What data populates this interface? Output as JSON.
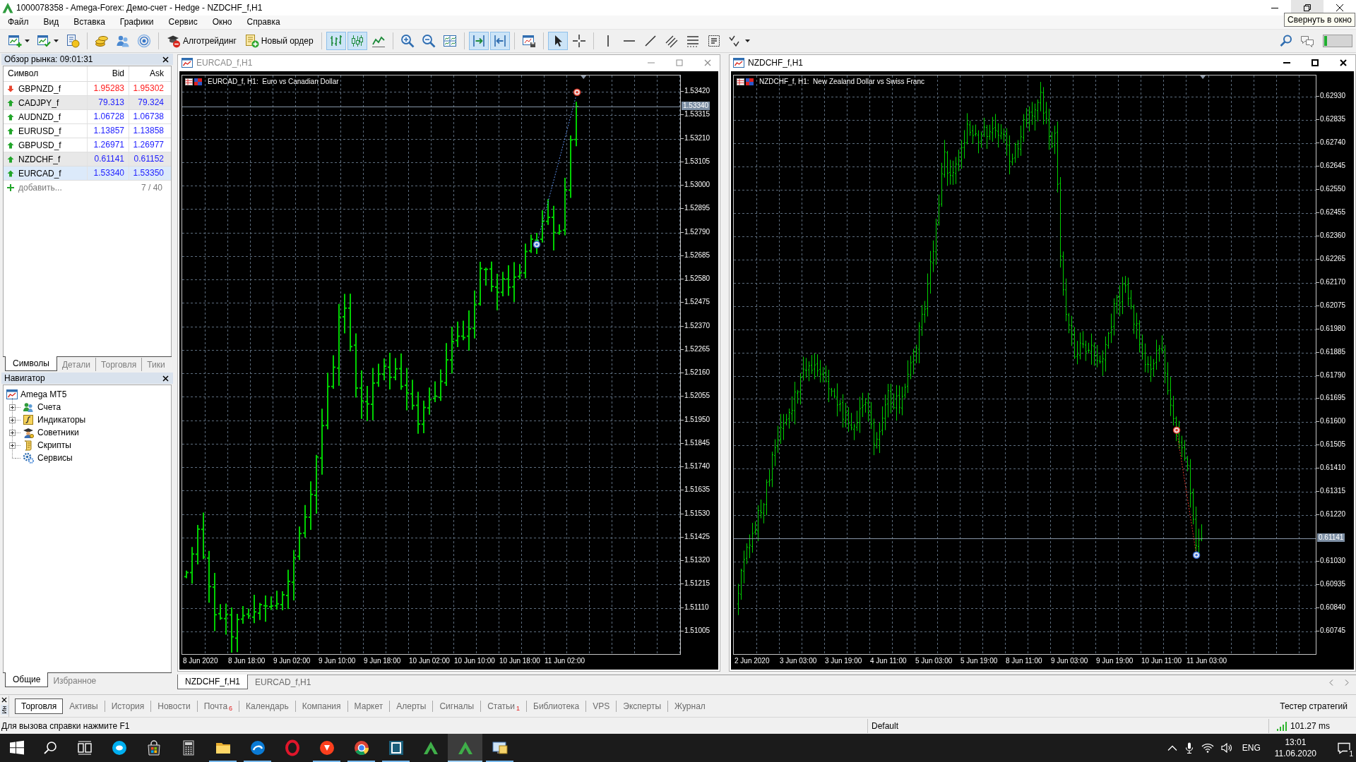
{
  "window": {
    "title": "1000078358 - Amega-Forex: Демо-счет - Hedge - NZDCHF_f,H1",
    "tooltip": "Свернуть в окно",
    "controls": [
      {
        "hovered": false
      },
      {
        "hovered": true
      },
      {
        "hovered": false
      }
    ]
  },
  "menu": [
    "Файл",
    "Вид",
    "Вставка",
    "Графики",
    "Сервис",
    "Окно",
    "Справка"
  ],
  "toolbar": {
    "buttons": [
      {
        "label": "Алготрейдинг"
      },
      {
        "label": "Новый ордер"
      }
    ],
    "chart_types": [
      {
        "selected": true
      },
      {
        "selected": true
      },
      {
        "selected": false
      }
    ],
    "view_toggles": [
      {
        "on": true
      },
      {
        "on": true
      }
    ],
    "cursor_tools": [
      {
        "selected": true
      },
      {
        "selected": false
      }
    ]
  },
  "market_watch": {
    "title": "Обзор рынка: 09:01:31",
    "columns": [
      "Символ",
      "Bid",
      "Ask"
    ],
    "rows": [
      {
        "symbol": "GBPNZD_f",
        "bid": "1.95283",
        "ask": "1.95302",
        "rising": false,
        "highlighted": false,
        "selected": false
      },
      {
        "symbol": "CADJPY_f",
        "bid": "79.313",
        "ask": "79.324",
        "rising": true,
        "highlighted": true,
        "selected": false
      },
      {
        "symbol": "AUDNZD_f",
        "bid": "1.06728",
        "ask": "1.06738",
        "rising": true,
        "highlighted": false,
        "selected": false
      },
      {
        "symbol": "EURUSD_f",
        "bid": "1.13857",
        "ask": "1.13858",
        "rising": true,
        "highlighted": false,
        "selected": false
      },
      {
        "symbol": "GBPUSD_f",
        "bid": "1.26971",
        "ask": "1.26977",
        "rising": true,
        "highlighted": false,
        "selected": false
      },
      {
        "symbol": "NZDCHF_f",
        "bid": "0.61141",
        "ask": "0.61152",
        "rising": true,
        "highlighted": true,
        "selected": false
      },
      {
        "symbol": "EURCAD_f",
        "bid": "1.53340",
        "ask": "1.53350",
        "rising": true,
        "highlighted": false,
        "selected": true
      }
    ],
    "add_label": "добавить...",
    "count": "7 / 40",
    "tabs": [
      {
        "label": "Символы",
        "selected": true
      },
      {
        "label": "Детали",
        "selected": false
      },
      {
        "label": "Торговля",
        "selected": false
      },
      {
        "label": "Тики",
        "selected": false
      }
    ]
  },
  "navigator": {
    "title": "Навигатор",
    "tree": [
      {
        "label": "Amega MT5",
        "expandable": false,
        "children": [
          {
            "label": "Счета",
            "expandable": true
          },
          {
            "label": "Индикаторы",
            "expandable": true
          },
          {
            "label": "Советники",
            "expandable": true
          },
          {
            "label": "Скрипты",
            "expandable": true
          },
          {
            "label": "Сервисы",
            "expandable": false
          }
        ]
      }
    ],
    "tabs": [
      {
        "label": "Общие",
        "selected": true
      },
      {
        "label": "Избранное",
        "selected": false
      }
    ]
  },
  "charts": [
    {
      "title": "EURCAD_f,H1",
      "active": false,
      "header": "EURCAD_f, H1:  Euro vs Canadian Dollar",
      "price_axis": [
        "1.53420",
        "1.53315",
        "1.53210",
        "1.53105",
        "1.53000",
        "1.52895",
        "1.52790",
        "1.52685",
        "1.52580",
        "1.52475",
        "1.52370",
        "1.52265",
        "1.52160",
        "1.52055",
        "1.51950",
        "1.51845",
        "1.51740",
        "1.51635",
        "1.51530",
        "1.51425",
        "1.51320",
        "1.51215",
        "1.51110",
        "1.51005"
      ],
      "current_price": "1.53340",
      "time_axis": [
        "8 Jun 2020",
        "8 Jun 18:00",
        "9 Jun 02:00",
        "9 Jun 10:00",
        "9 Jun 18:00",
        "10 Jun 02:00",
        "10 Jun 10:00",
        "10 Jun 18:00",
        "11 Jun 02:00"
      ]
    },
    {
      "title": "NZDCHF_f,H1",
      "active": true,
      "header": "NZDCHF_f, H1:  New Zealand Dollar vs Swiss Franc",
      "price_axis": [
        "0.62930",
        "0.62835",
        "0.62740",
        "0.62645",
        "0.62550",
        "0.62455",
        "0.62360",
        "0.62265",
        "0.62170",
        "0.62075",
        "0.61980",
        "0.61885",
        "0.61790",
        "0.61695",
        "0.61600",
        "0.61505",
        "0.61410",
        "0.61315",
        "0.61220",
        "0.61030",
        "0.60935",
        "0.60840",
        "0.60745"
      ],
      "current_price": "0.61141",
      "time_axis": [
        "2 Jun 2020",
        "3 Jun 03:00",
        "3 Jun 19:00",
        "4 Jun 11:00",
        "5 Jun 03:00",
        "5 Jun 19:00",
        "8 Jun 11:00",
        "9 Jun 03:00",
        "9 Jun 19:00",
        "10 Jun 11:00",
        "11 Jun 03:00"
      ]
    }
  ],
  "chart_tabs": [
    {
      "label": "NZDCHF_f,H1",
      "selected": true
    },
    {
      "label": "EURCAD_f,H1",
      "selected": false
    }
  ],
  "toolbox": {
    "side_label": "Ин",
    "tabs": [
      {
        "label": "Торговля",
        "selected": true
      },
      {
        "label": "Активы",
        "selected": false
      },
      {
        "label": "История",
        "selected": false
      },
      {
        "label": "Новости",
        "selected": false
      },
      {
        "label": "Почта",
        "badge": "6",
        "selected": false
      },
      {
        "label": "Календарь",
        "selected": false
      },
      {
        "label": "Компания",
        "selected": false
      },
      {
        "label": "Маркет",
        "selected": false
      },
      {
        "label": "Алерты",
        "selected": false
      },
      {
        "label": "Сигналы",
        "selected": false
      },
      {
        "label": "Статьи",
        "badge": "1",
        "selected": false
      },
      {
        "label": "Библиотека",
        "selected": false
      },
      {
        "label": "VPS",
        "selected": false
      },
      {
        "label": "Эксперты",
        "selected": false
      },
      {
        "label": "Журнал",
        "selected": false
      }
    ],
    "tester": "Тестер стратегий"
  },
  "status_bar": {
    "help": "Для вызова справки нажмите F1",
    "profile": "Default",
    "ping": "101.27 ms"
  },
  "taskbar": {
    "apps": [
      {
        "active": false,
        "running": false
      },
      {
        "active": false,
        "running": false
      },
      {
        "active": false,
        "running": false
      },
      {
        "active": false,
        "running": true
      },
      {
        "active": false,
        "running": true
      },
      {
        "active": false,
        "running": false
      },
      {
        "active": false,
        "running": true
      },
      {
        "active": false,
        "running": true
      },
      {
        "active": false,
        "running": true
      },
      {
        "active": false,
        "running": false
      },
      {
        "active": true,
        "running": true
      },
      {
        "active": false,
        "running": true
      }
    ],
    "tray": {
      "language": "ENG",
      "time": "13:01",
      "date": "11.06.2020",
      "notifications": "1"
    }
  }
}
